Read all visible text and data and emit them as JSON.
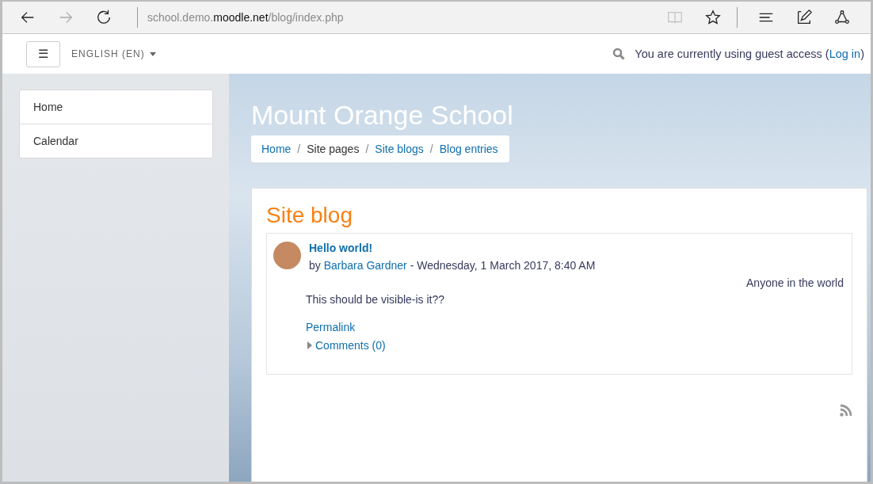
{
  "browser": {
    "url": {
      "prefix": "school.demo.",
      "domain": "moodle.net",
      "path": "/blog/index.php"
    },
    "reading_view_disabled": true
  },
  "navbar": {
    "menu_button": "☰",
    "language": "ENGLISH (EN)",
    "guest_text": "You are currently using guest access (",
    "login_link": "Log in",
    "guest_suffix": ")"
  },
  "sidebar": {
    "items": [
      {
        "label": "Home"
      },
      {
        "label": "Calendar"
      }
    ]
  },
  "header": {
    "title": "Mount Orange School",
    "separators": [
      "/",
      "/",
      "/"
    ],
    "breadcrumbs": [
      {
        "label": "Home",
        "kind": "link"
      },
      {
        "label": "Site pages",
        "kind": "text"
      },
      {
        "label": "Site blogs",
        "kind": "link"
      },
      {
        "label": "Blog entries",
        "kind": "link"
      }
    ]
  },
  "main": {
    "heading": "Site blog",
    "entry": {
      "title": "Hello world!",
      "by": "by ",
      "author": "Barbara Gardner",
      "date": " - Wednesday, 1 March 2017, 8:40 AM",
      "visibility": "Anyone in the world",
      "body": "This should be visible-is it??",
      "permalink": "Permalink",
      "comments": "Comments (0)",
      "comments_expanded": false
    }
  }
}
